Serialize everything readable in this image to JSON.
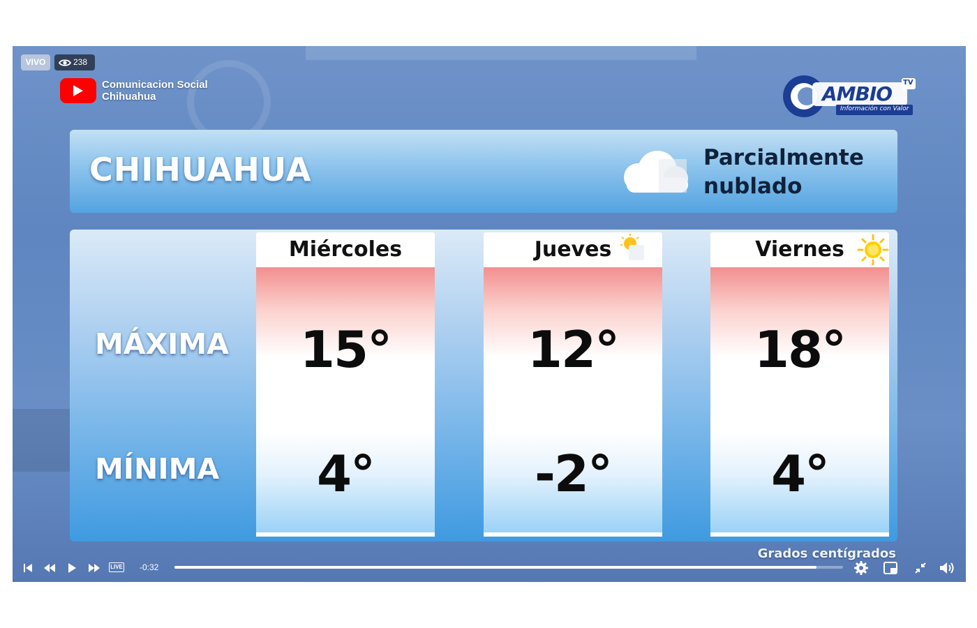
{
  "player": {
    "live_badge": "VIVO",
    "viewer_count": "238",
    "time_remaining": "-0:32",
    "live_chip": "LIVE",
    "progress": 0.96
  },
  "channel": {
    "name_line1": "Comunicacion Social",
    "name_line2": "Chihuahua"
  },
  "brand": {
    "name": "AMBIO",
    "suffix": "TV",
    "tagline": "Información con Valor"
  },
  "forecast": {
    "city": "CHIHUAHUA",
    "condition_line1": "Parcialmente",
    "condition_line2": "nublado",
    "row_max": "MÁXIMA",
    "row_min": "MÍNIMA",
    "days": [
      {
        "name": "Miércoles",
        "max": "15°",
        "min": "4°",
        "icon": "none"
      },
      {
        "name": "Jueves",
        "max": "12°",
        "min": "-2°",
        "icon": "sun-cloud-icon"
      },
      {
        "name": "Viernes",
        "max": "18°",
        "min": "4°",
        "icon": "sun-icon"
      }
    ],
    "unit_note": "Grados centígrados"
  },
  "colors": {
    "youtube_red": "#ff0000",
    "brand_blue": "#1d3f9a",
    "max_gradient_top": "#f28f8f",
    "min_gradient_bottom": "#9cd2f6"
  }
}
